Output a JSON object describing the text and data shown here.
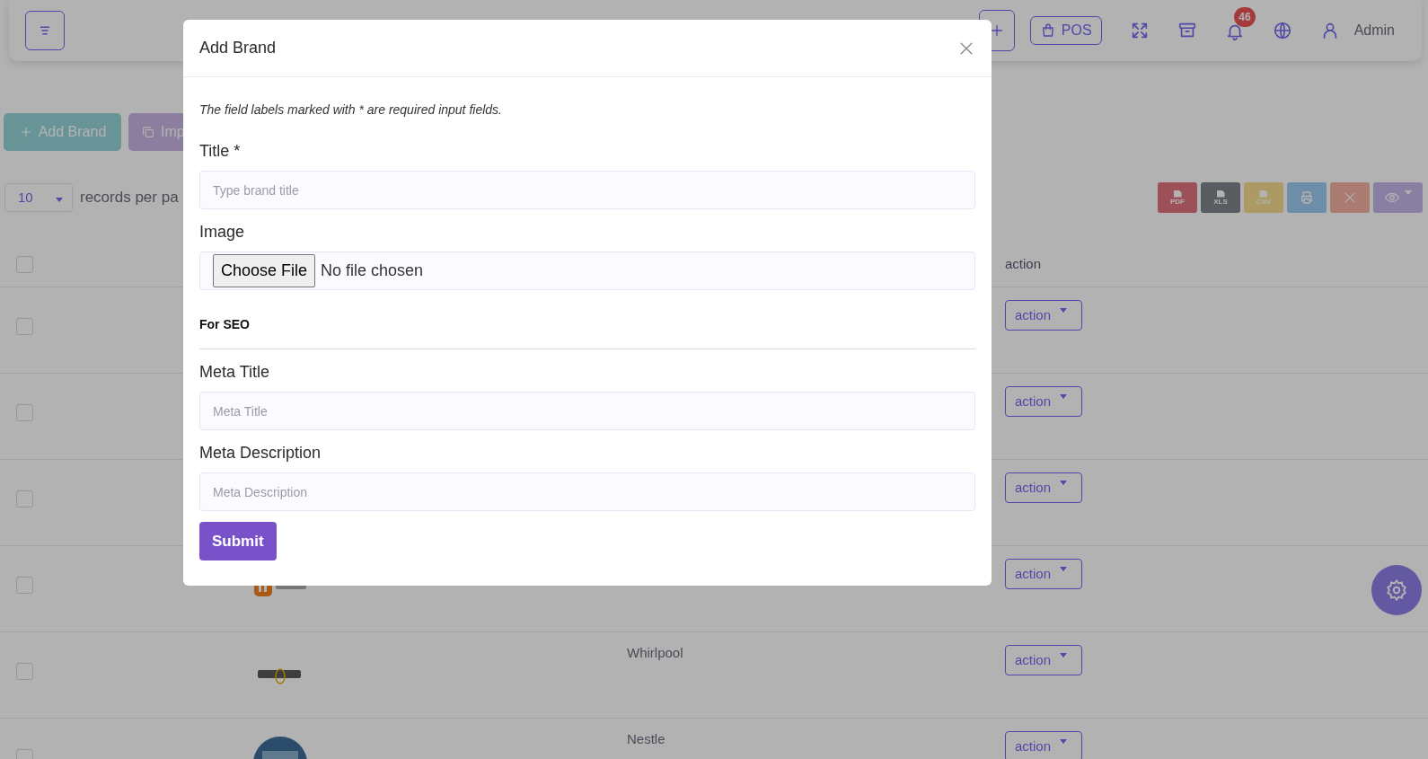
{
  "header": {
    "pos_button": "POS",
    "notification_count": "46",
    "user": "Admin"
  },
  "toolbar": [
    {
      "kind": "add",
      "label": "Add Brand"
    },
    {
      "kind": "import",
      "label": "Imp"
    }
  ],
  "table_controls": {
    "page_size": "10",
    "page_size_label": "records per pa",
    "export_buttons": [
      {
        "kind": "pdf",
        "label": "PDF"
      },
      {
        "kind": "xls",
        "label": "XLS"
      },
      {
        "kind": "csv",
        "label": "CSV"
      },
      {
        "kind": "print"
      },
      {
        "kind": "clear"
      },
      {
        "kind": "columns"
      }
    ]
  },
  "table": {
    "action_header": "action",
    "header_checked": false,
    "rows": [
      {
        "checked": false,
        "action": "action"
      },
      {
        "checked": false,
        "action": "action"
      },
      {
        "checked": false,
        "action": "action"
      },
      {
        "checked": false,
        "logo": {
          "kind": "tile"
        },
        "action": "action"
      },
      {
        "checked": false,
        "logo": {
          "kind": "wordmark"
        },
        "name": "Whirlpool",
        "action": "action"
      },
      {
        "checked": false,
        "logo": {
          "kind": "disc"
        },
        "name": "Nestle",
        "action": "action"
      }
    ]
  },
  "modal": {
    "title": "Add Brand",
    "note": "The field labels marked with * are required input fields.",
    "fields": [
      {
        "kind": "text",
        "label": "Title *",
        "placeholder": "Type brand title"
      },
      {
        "kind": "file",
        "label": "Image",
        "button": "Choose File",
        "value": "No file chosen"
      },
      {
        "kind": "section",
        "label": "For SEO"
      },
      {
        "kind": "text",
        "label": "Meta Title",
        "placeholder": "Meta Title"
      },
      {
        "kind": "text",
        "label": "Meta Description",
        "placeholder": "Meta Description"
      }
    ],
    "submit": "Submit"
  }
}
